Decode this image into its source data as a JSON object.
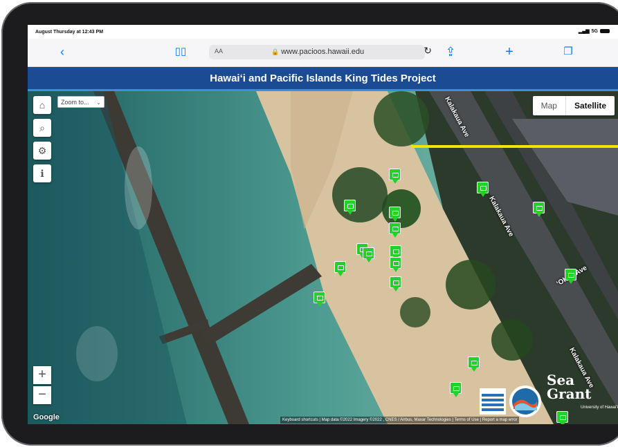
{
  "status_bar": {
    "time": "August Thursday at 12:43 PM",
    "network": "5G"
  },
  "browser": {
    "back_icon": "chevron-left-icon",
    "reader_label": "AA",
    "url": "www.pacioos.hawaii.edu",
    "icons": [
      "book-icon",
      "lock-icon",
      "reload-icon",
      "share-icon",
      "plus-icon",
      "tabs-icon"
    ]
  },
  "banner": {
    "title": "Hawaiʻi and Pacific Islands King Tides Project"
  },
  "map": {
    "zoom_select": "Zoom to...",
    "type_options": [
      "Map",
      "Satellite"
    ],
    "selected_type": "Satellite",
    "zoom_in": "+",
    "zoom_out": "−",
    "roads": [
      "Kalakaua Ave",
      "Kalakaua Ave",
      "Kalakaua Ave",
      "ʻOhua Ave"
    ],
    "google": "Google",
    "attribution": "Keyboard shortcuts | Map data ©2022 Imagery ©2022 , CNES / Airbus, Maxar Technologies | Terms of Use | Report a map error",
    "logos": {
      "seagrant": "Sea Grant",
      "seagrant_sub": "University of Hawaiʻi"
    }
  },
  "colors": {
    "banner": "#1b4b92",
    "marker": "#22d22a",
    "pointer": "#f2e600"
  }
}
